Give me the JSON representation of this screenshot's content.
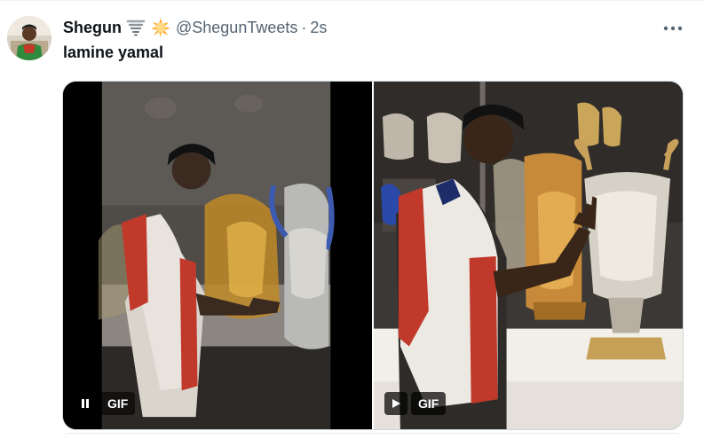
{
  "tweet": {
    "author": {
      "name": "Shegun",
      "handle": "@ShegunTweets",
      "badges": [
        "tornado-emoji",
        "sun-emoji"
      ]
    },
    "separator": "·",
    "timestamp": "2s",
    "text": "lamine yamal",
    "more_icon": "more-horizontal-icon"
  },
  "media": {
    "items": [
      {
        "type": "gif",
        "label": "GIF",
        "control": "pause-icon"
      },
      {
        "type": "gif",
        "label": "GIF",
        "control": "play-icon"
      }
    ]
  },
  "colors": {
    "text_primary": "#0f1419",
    "text_secondary": "#536471",
    "border": "#cfd9de"
  }
}
